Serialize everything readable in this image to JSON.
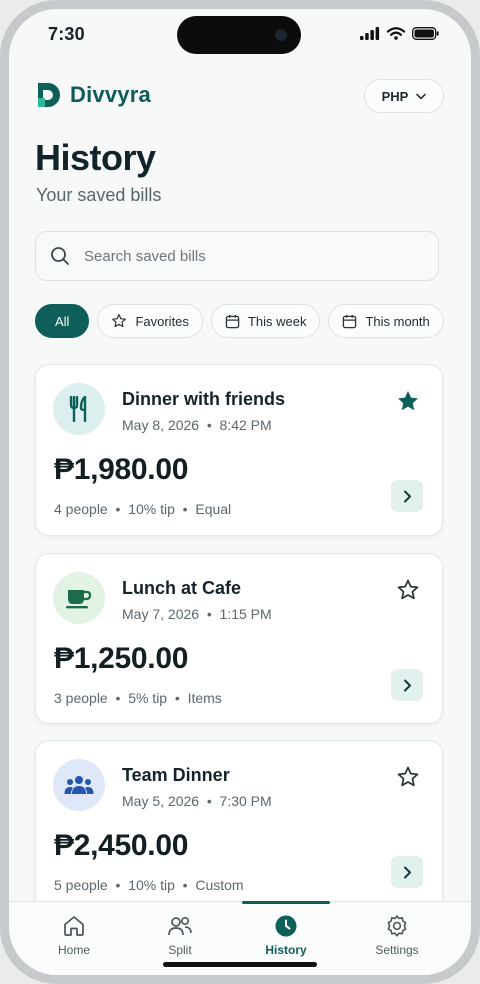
{
  "status_bar": {
    "time": "7:30"
  },
  "header": {
    "brand": "Divvyra",
    "currency": "PHP"
  },
  "page": {
    "title": "History",
    "subtitle": "Your saved bills"
  },
  "search": {
    "placeholder": "Search saved bills",
    "value": ""
  },
  "filters": [
    {
      "label": "All",
      "active": true
    },
    {
      "label": "Favorites",
      "icon": "star-outline-icon"
    },
    {
      "label": "This week",
      "icon": "calendar-icon"
    },
    {
      "label": "This month",
      "icon": "calendar-icon"
    }
  ],
  "bills": [
    {
      "name": "Dinner with friends",
      "date": "May 8, 2026",
      "time": "8:42 PM",
      "amount": "₱1,980.00",
      "people": "4 people",
      "tip": "10% tip",
      "split": "Equal",
      "favorite": true,
      "icon": "utensils-icon",
      "icon_bg": "#dcefee",
      "icon_color": "#0e5f5a"
    },
    {
      "name": "Lunch at Cafe",
      "date": "May 7, 2026",
      "time": "1:15 PM",
      "amount": "₱1,250.00",
      "people": "3 people",
      "tip": "5% tip",
      "split": "Items",
      "favorite": false,
      "icon": "coffee-cup-icon",
      "icon_bg": "#e2f3e5",
      "icon_color": "#1c6b4a"
    },
    {
      "name": "Team Dinner",
      "date": "May 5, 2026",
      "time": "7:30 PM",
      "amount": "₱2,450.00",
      "people": "5 people",
      "tip": "10% tip",
      "split": "Custom",
      "favorite": false,
      "icon": "group-icon",
      "icon_bg": "#dfe8f7",
      "icon_color": "#2557a8"
    }
  ],
  "nav": [
    {
      "label": "Home",
      "icon": "home-icon"
    },
    {
      "label": "Split",
      "icon": "people-icon"
    },
    {
      "label": "History",
      "icon": "clock-icon",
      "active": true
    },
    {
      "label": "Settings",
      "icon": "gear-icon"
    }
  ],
  "colors": {
    "accent": "#0e5f5a",
    "accent_light": "#e3f1ee"
  }
}
